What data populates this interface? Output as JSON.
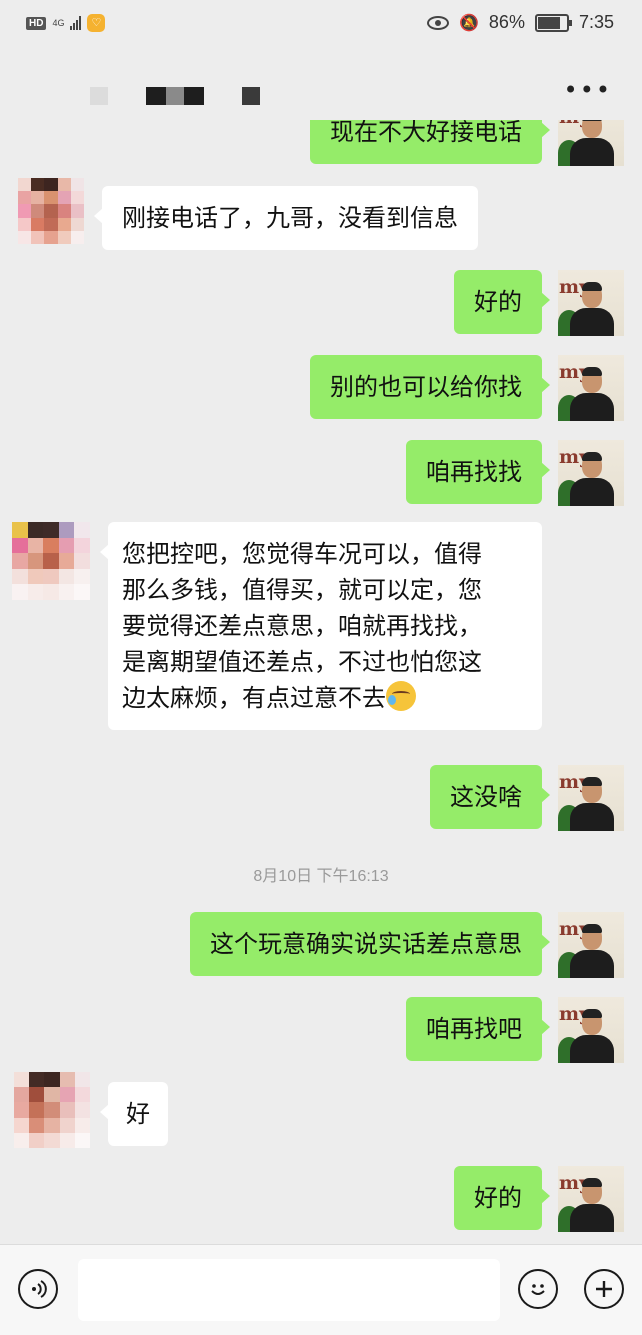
{
  "status_bar": {
    "hd_label": "HD",
    "network_label": "4G",
    "battery_percent": "86%",
    "battery_level": 0.86,
    "time": "7:35"
  },
  "header": {
    "more_icon": "more-dots-icon"
  },
  "messages": [
    {
      "id": "m0",
      "side": "self",
      "text": "现在不大好接电话"
    },
    {
      "id": "m1",
      "side": "other",
      "text": "刚接电话了，九哥，没看到信息"
    },
    {
      "id": "m2",
      "side": "self",
      "text": "好的"
    },
    {
      "id": "m3",
      "side": "self",
      "text": "别的也可以给你找"
    },
    {
      "id": "m4",
      "side": "self",
      "text": "咱再找找"
    },
    {
      "id": "m5",
      "side": "other",
      "lines": [
        "您把控吧，您觉得车况可以，值得",
        "那么多钱，值得买，就可以定，您",
        "要觉得还差点意思，咱就再找找，",
        "是离期望值还差点，不过也怕您这",
        "边太麻烦，有点过意不去"
      ],
      "trailing_emoji": "facepalm-emoji"
    },
    {
      "id": "m6",
      "side": "self",
      "text": "这没啥"
    },
    {
      "id": "m7",
      "side": "self",
      "text": "这个玩意确实说实话差点意思"
    },
    {
      "id": "m8",
      "side": "self",
      "text": "咱再找吧"
    },
    {
      "id": "m9",
      "side": "other",
      "text": "好"
    },
    {
      "id": "m10",
      "side": "self",
      "text": "好的"
    }
  ],
  "timestamp": "8月10日 下午16:13",
  "self_avatar_text": "my",
  "input_bar": {
    "voice_icon": "voice-icon",
    "emoji_icon": "emoji-icon",
    "plus_icon": "plus-icon",
    "input_value": ""
  },
  "colors": {
    "background": "#ededed",
    "self_bubble": "#95ec69",
    "other_bubble": "#ffffff",
    "timestamp_text": "#9a9a9a"
  }
}
